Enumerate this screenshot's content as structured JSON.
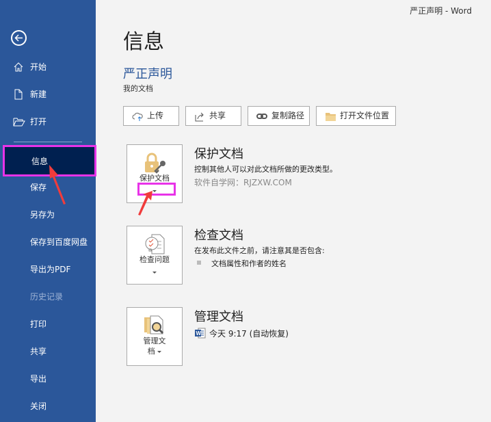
{
  "window_title": "严正声明  -  Word",
  "sidebar": {
    "back": "back-arrow",
    "items": [
      {
        "label": "开始",
        "icon": "home-icon"
      },
      {
        "label": "新建",
        "icon": "new-doc-icon"
      },
      {
        "label": "打开",
        "icon": "folder-open-icon"
      },
      {
        "label": "信息",
        "selected": true
      },
      {
        "label": "保存"
      },
      {
        "label": "另存为"
      },
      {
        "label": "保存到百度网盘"
      },
      {
        "label": "导出为PDF"
      },
      {
        "label": "历史记录",
        "disabled": true
      },
      {
        "label": "打印"
      },
      {
        "label": "共享"
      },
      {
        "label": "导出"
      },
      {
        "label": "关闭"
      }
    ]
  },
  "main": {
    "heading": "信息",
    "doc_name": "严正声明",
    "doc_location": "我的文档",
    "actions": [
      {
        "label": "上传"
      },
      {
        "label": "共享"
      },
      {
        "label": "复制路径"
      },
      {
        "label": "打开文件位置"
      }
    ],
    "protect": {
      "card_label": "保护文档",
      "title": "保护文档",
      "desc": "控制其他人可以对此文档所做的更改类型。",
      "watermark": "软件自学网：RJZXW.COM"
    },
    "inspect": {
      "card_label": "检查问题",
      "title": "检查文档",
      "desc": "在发布此文件之前，请注意其是否包含:",
      "bullet": "文档属性和作者的姓名"
    },
    "manage": {
      "card_label_1": "管理文",
      "card_label_2": "档",
      "title": "管理文档",
      "version": "今天 9:17 (自动恢复)"
    }
  },
  "colors": {
    "sidebar": "#2b579a",
    "selected": "#002050",
    "highlight": "#e833e8",
    "arrow": "#f03c3c"
  }
}
